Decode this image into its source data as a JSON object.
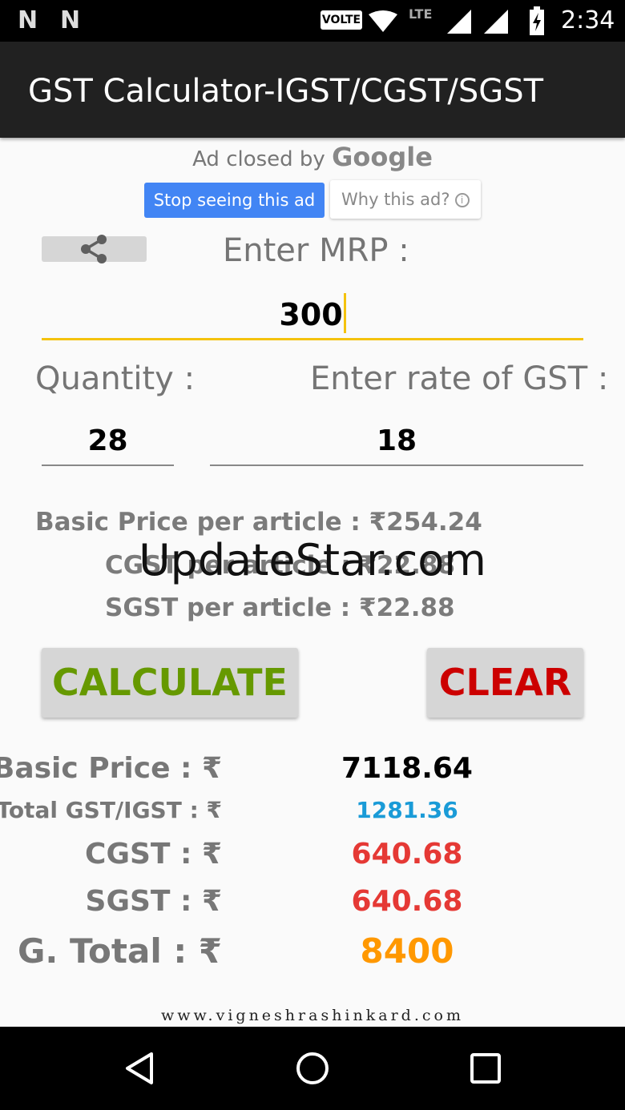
{
  "status_bar": {
    "time": "2:34",
    "volte": "VOLTE",
    "lte": "LTE",
    "icons": [
      "notification-n-icon",
      "notification-n-icon",
      "wifi-icon",
      "signal-icon",
      "signal-icon",
      "battery-charging-icon"
    ]
  },
  "app_bar": {
    "title": "GST Calculator-IGST/CGST/SGST"
  },
  "ad": {
    "closed_prefix": "Ad closed by",
    "closed_brand": "Google",
    "stop_button": "Stop seeing this ad",
    "why_button": "Why this ad?"
  },
  "form": {
    "mrp_label": "Enter MRP :",
    "mrp_value": "300",
    "quantity_label": "Quantity :",
    "quantity_value": "28",
    "gst_rate_label": "Enter rate of GST :",
    "gst_rate_value": "18"
  },
  "per_article": {
    "basic_price": "Basic Price per article : ₹254.24",
    "cgst": "CGST per article : ₹22.88",
    "sgst": "SGST per article : ₹22.88"
  },
  "watermark": "UpdateStar.com",
  "buttons": {
    "calculate": "CALCULATE",
    "clear": "CLEAR"
  },
  "results": {
    "basic_price_label": "Basic Price : ₹",
    "basic_price_value": "7118.64",
    "total_gst_label": "Total GST/IGST : ₹",
    "total_gst_value": "1281.36",
    "cgst_label": "CGST : ₹",
    "cgst_value": "640.68",
    "sgst_label": "SGST : ₹",
    "sgst_value": "640.68",
    "grand_total_label": "G. Total : ₹",
    "grand_total_value": "8400"
  },
  "footer": {
    "website": "www.vigneshrashinkard.com"
  },
  "colors": {
    "accent_yellow": "#f4c20d",
    "calculate_green": "#669900",
    "clear_red": "#cc0000",
    "total_gst_blue": "#1a9bd7",
    "cgst_sgst_red": "#e53935",
    "grand_total_orange": "#ff9800",
    "google_blue": "#4285f4"
  }
}
